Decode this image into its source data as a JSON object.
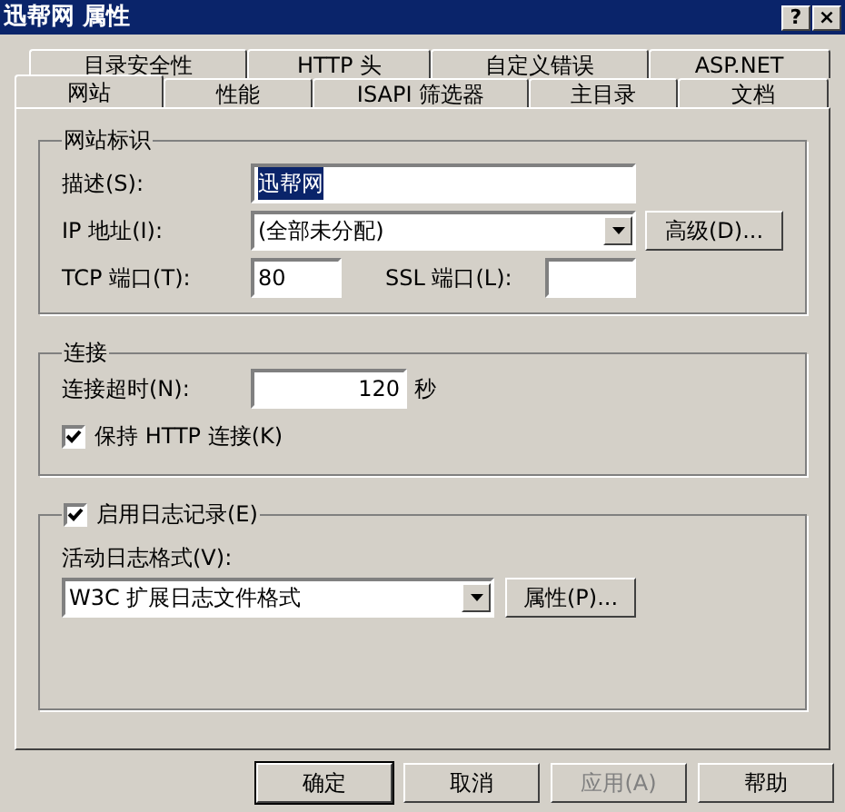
{
  "window": {
    "title": "迅帮网 属性",
    "controls": [
      "?",
      "×"
    ]
  },
  "tab_rows": [
    [
      {
        "label": "目录安全性",
        "selected": false
      },
      {
        "label": "HTTP 头",
        "selected": false
      },
      {
        "label": "自定义错误",
        "selected": false
      },
      {
        "label": "ASP.NET",
        "selected": false
      }
    ],
    [
      {
        "label": "网站",
        "selected": true
      },
      {
        "label": "性能",
        "selected": false
      },
      {
        "label": "ISAPI 筛选器",
        "selected": false
      },
      {
        "label": "主目录",
        "selected": false
      },
      {
        "label": "文档",
        "selected": false
      }
    ]
  ],
  "site_identification": {
    "title": "网站标识",
    "description_label": "描述(S):",
    "description_value": "迅帮网",
    "ip_label": "IP 地址(I):",
    "ip_value": "(全部未分配)",
    "advanced_button": "高级(D)...",
    "tcp_label": "TCP 端口(T):",
    "tcp_value": "80",
    "ssl_label": "SSL 端口(L):"
  },
  "connections": {
    "title": "连接",
    "timeout_label": "连接超时(N):",
    "timeout_value": "120",
    "timeout_unit": "秒",
    "keep_alive": {
      "label": "保持 HTTP 连接(K)",
      "checked": true
    }
  },
  "logging": {
    "enable": {
      "label": "启用日志记录(E)",
      "checked": true
    },
    "format_label": "活动日志格式(V):",
    "format_value": "W3C 扩展日志文件格式",
    "properties_button": "属性(P)..."
  },
  "buttons": [
    {
      "label": "确定",
      "default": true,
      "disabled": false
    },
    {
      "label": "取消",
      "default": false,
      "disabled": false
    },
    {
      "label": "应用(A)",
      "default": false,
      "disabled": true
    },
    {
      "label": "帮助",
      "default": false,
      "disabled": false
    }
  ]
}
